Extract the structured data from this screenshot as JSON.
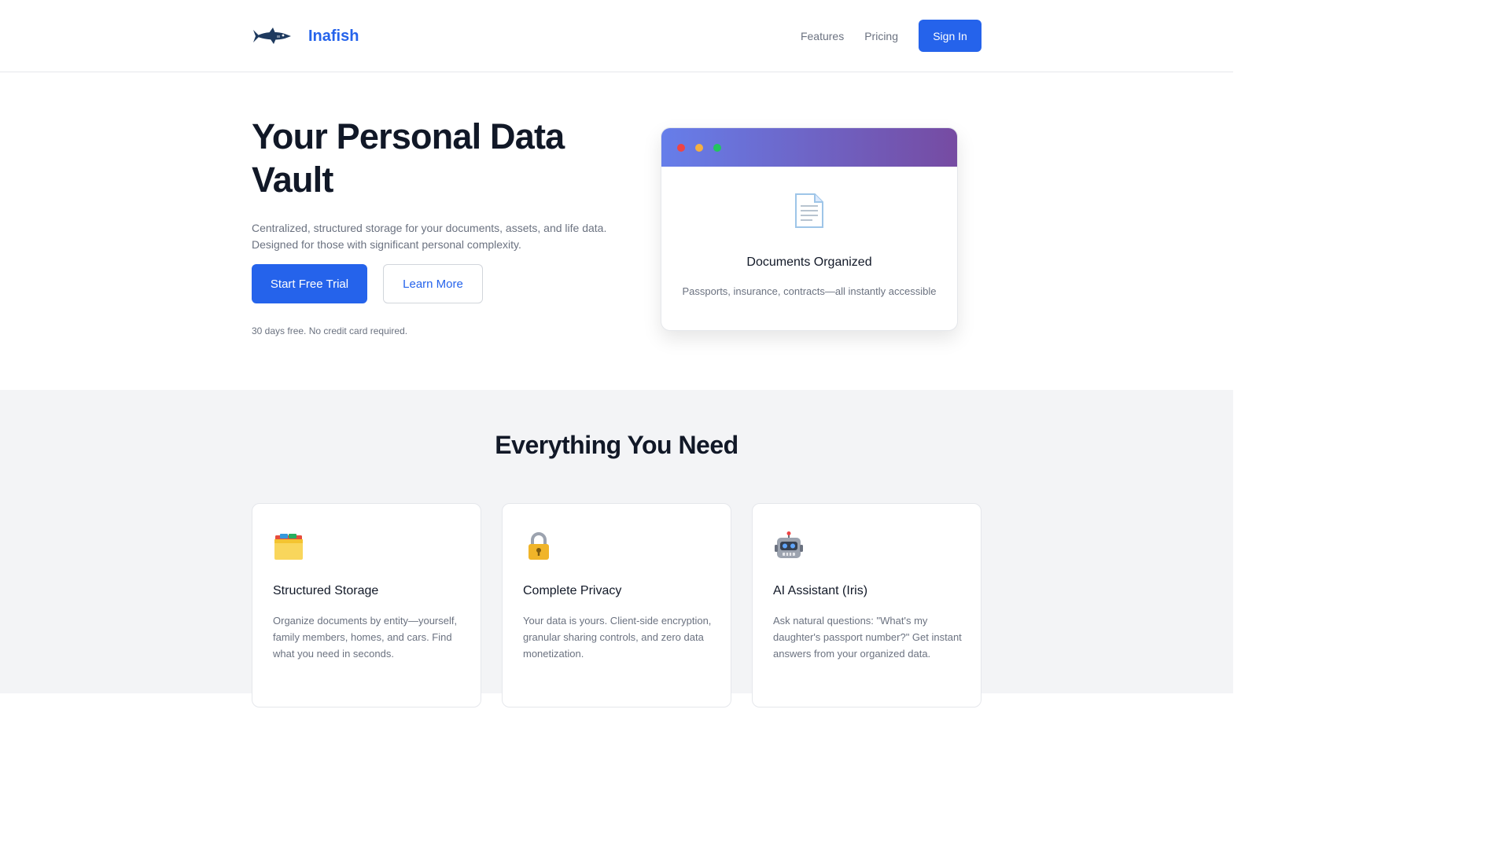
{
  "header": {
    "brand": "Inafish",
    "nav": [
      {
        "label": "Features"
      },
      {
        "label": "Pricing"
      }
    ],
    "signin_label": "Sign In"
  },
  "hero": {
    "title": "Your Personal Data Vault",
    "subtitle": "Centralized, structured storage for your documents, assets, and life data. Designed for those with significant personal complexity.",
    "primary_cta": "Start Free Trial",
    "secondary_cta": "Learn More",
    "note": "30 days free. No credit card required."
  },
  "preview": {
    "icon": "document-icon",
    "title": "Documents Organized",
    "text": "Passports, insurance, contracts—all instantly accessible"
  },
  "features": {
    "title": "Everything You Need",
    "cards": [
      {
        "icon": "card-file-box-icon",
        "title": "Structured Storage",
        "desc": "Organize documents by entity—yourself, family members, homes, and cars. Find what you need in seconds."
      },
      {
        "icon": "lock-icon",
        "title": "Complete Privacy",
        "desc": "Your data is yours. Client-side encryption, granular sharing controls, and zero data monetization."
      },
      {
        "icon": "robot-icon",
        "title": "AI Assistant (Iris)",
        "desc": "Ask natural questions: \"What's my daughter's passport number?\" Get instant answers from your organized data."
      }
    ]
  },
  "colors": {
    "accent": "#2563eb",
    "heading": "#111827",
    "muted": "#6b7280",
    "gradient_start": "#667eea",
    "gradient_end": "#764ba2"
  }
}
